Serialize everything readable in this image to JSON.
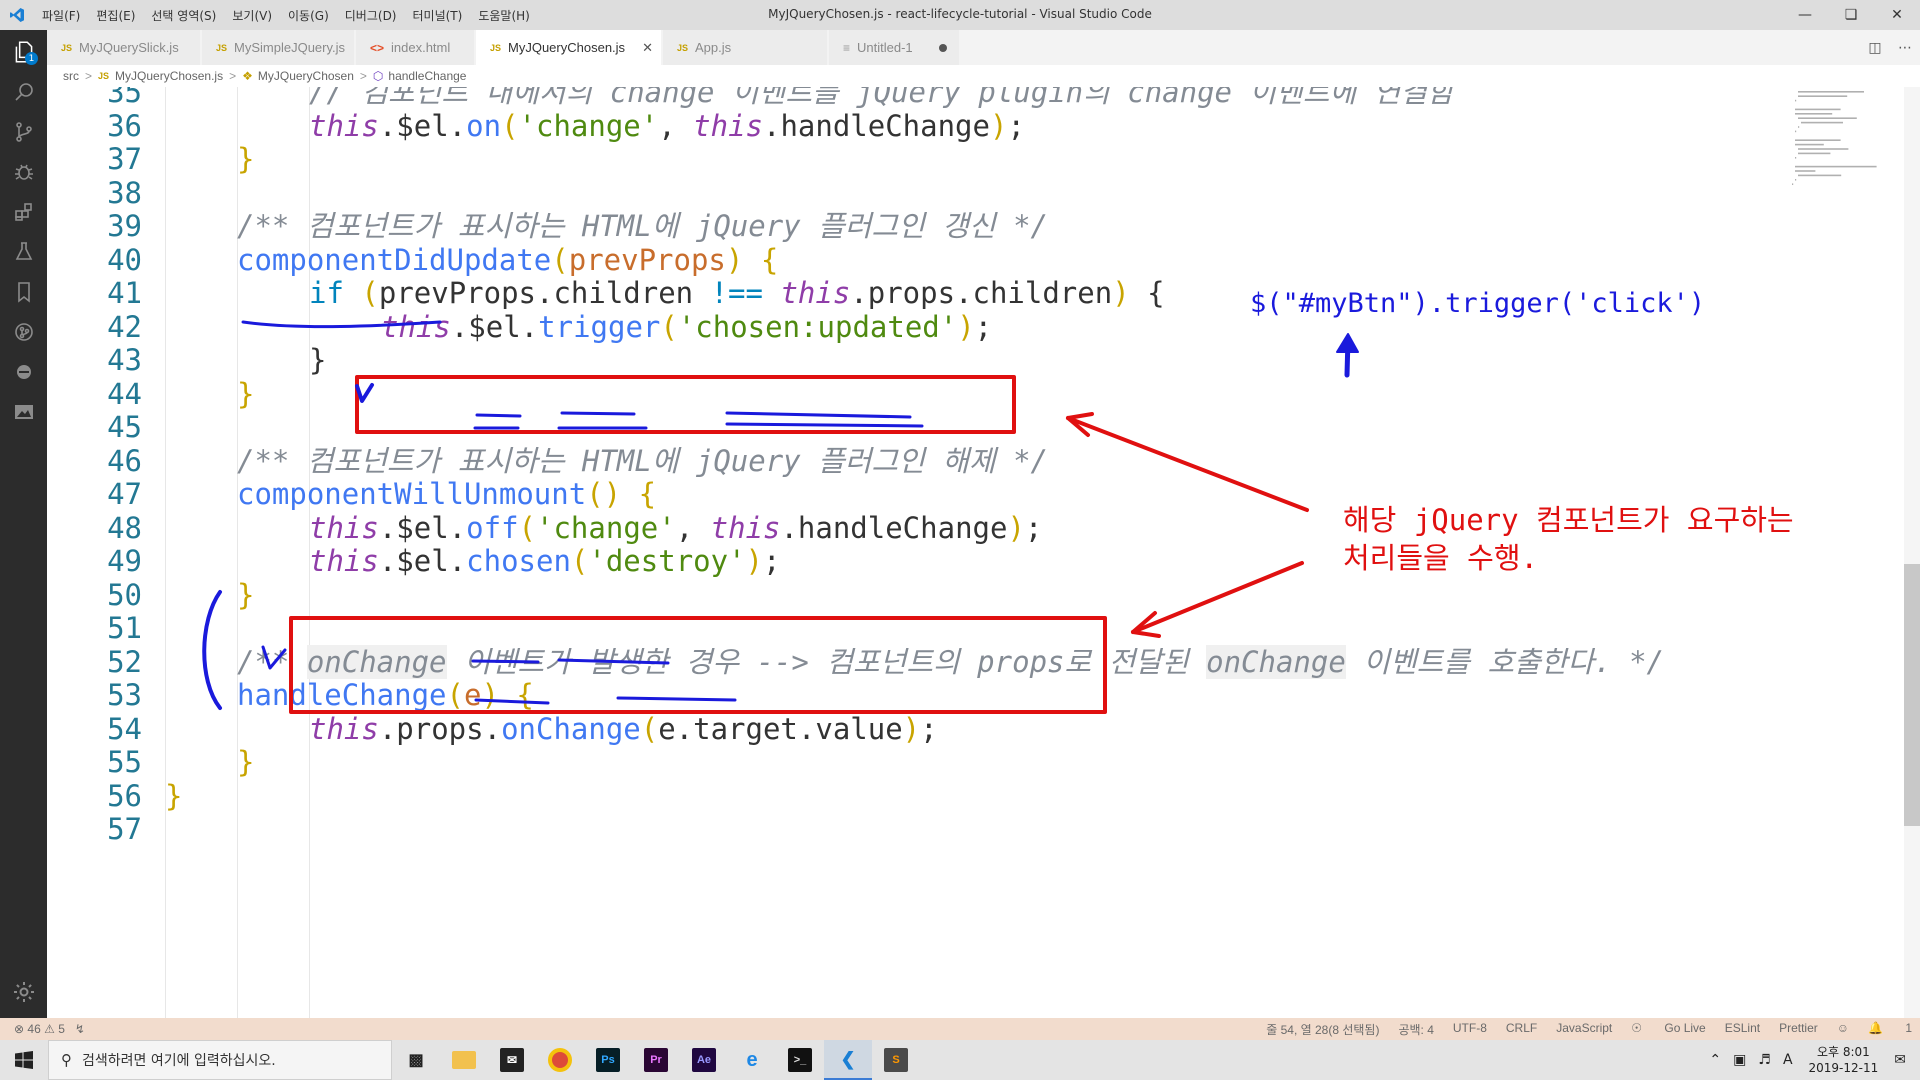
{
  "window": {
    "title": "MyJQueryChosen.js - react-lifecycle-tutorial - Visual Studio Code",
    "menu": [
      "파일(F)",
      "편집(E)",
      "선택 영역(S)",
      "보기(V)",
      "이동(G)",
      "디버그(D)",
      "터미널(T)",
      "도움말(H)"
    ]
  },
  "activity": {
    "badge": "1"
  },
  "tabs": [
    {
      "label": "MyJQuerySlick.js",
      "icon": "JS"
    },
    {
      "label": "MySimpleJQuery.js",
      "icon": "JS"
    },
    {
      "label": "index.html",
      "icon": "<>"
    },
    {
      "label": "MyJQueryChosen.js",
      "icon": "JS",
      "active": true
    },
    {
      "label": "App.js",
      "icon": "JS"
    },
    {
      "label": "Untitled-1",
      "icon": "≡",
      "dirty": true
    }
  ],
  "breadcrumb": [
    "src",
    "MyJQueryChosen.js",
    "MyJQueryChosen",
    "handleChange"
  ],
  "editor": {
    "lines": [
      {
        "n": "35",
        "i": 2,
        "t": [
          [
            "cm",
            "// 컴포넌트 내에서의 change 이벤트를 jQuery plugin의 change 이벤트에 연결함"
          ]
        ]
      },
      {
        "n": "36",
        "i": 2,
        "t": [
          [
            "kw",
            "this"
          ],
          [
            "df",
            ".$el."
          ],
          [
            "fn",
            "on"
          ],
          [
            "pu",
            "("
          ],
          [
            "st",
            "'change'"
          ],
          [
            "df",
            ", "
          ],
          [
            "kw",
            "this"
          ],
          [
            "df",
            ".handleChange"
          ],
          [
            "pu",
            ")"
          ],
          [
            "df",
            ";"
          ]
        ]
      },
      {
        "n": "37",
        "i": 1,
        "t": [
          [
            "pu",
            "}"
          ]
        ]
      },
      {
        "n": "38",
        "i": 0,
        "t": []
      },
      {
        "n": "39",
        "i": 1,
        "t": [
          [
            "cm",
            "/** 컴포넌트가 표시하는 HTML에 jQuery 플러그인 갱신 */"
          ]
        ]
      },
      {
        "n": "40",
        "i": 1,
        "t": [
          [
            "fn",
            "componentDidUpdate"
          ],
          [
            "pu",
            "("
          ],
          [
            "pm",
            "prevProps"
          ],
          [
            "pu",
            ")"
          ],
          [
            "df",
            " "
          ],
          [
            "pu",
            "{"
          ]
        ]
      },
      {
        "n": "41",
        "i": 2,
        "t": [
          [
            "op",
            "if"
          ],
          [
            "df",
            " "
          ],
          [
            "pu",
            "("
          ],
          [
            "df",
            "prevProps.children "
          ],
          [
            "op",
            "!=="
          ],
          [
            "df",
            " "
          ],
          [
            "kw",
            "this"
          ],
          [
            "df",
            ".props.children"
          ],
          [
            "pu",
            ")"
          ],
          [
            "df",
            " {"
          ]
        ]
      },
      {
        "n": "42",
        "i": 3,
        "t": [
          [
            "kw",
            "this"
          ],
          [
            "df",
            ".$el."
          ],
          [
            "fn",
            "trigger"
          ],
          [
            "pu",
            "("
          ],
          [
            "st",
            "'chosen:updated'"
          ],
          [
            "pu",
            ")"
          ],
          [
            "df",
            ";"
          ]
        ]
      },
      {
        "n": "43",
        "i": 2,
        "t": [
          [
            "df",
            "}"
          ]
        ]
      },
      {
        "n": "44",
        "i": 1,
        "t": [
          [
            "pu",
            "}"
          ]
        ]
      },
      {
        "n": "45",
        "i": 0,
        "t": []
      },
      {
        "n": "46",
        "i": 1,
        "t": [
          [
            "cm",
            "/** 컴포넌트가 표시하는 HTML에 jQuery 플러그인 해제 */"
          ]
        ]
      },
      {
        "n": "47",
        "i": 1,
        "t": [
          [
            "fn",
            "componentWillUnmount"
          ],
          [
            "pu",
            "()"
          ],
          [
            "df",
            " "
          ],
          [
            "pu",
            "{"
          ]
        ]
      },
      {
        "n": "48",
        "i": 2,
        "t": [
          [
            "kw",
            "this"
          ],
          [
            "df",
            ".$el."
          ],
          [
            "fn",
            "off"
          ],
          [
            "pu",
            "("
          ],
          [
            "st",
            "'change'"
          ],
          [
            "df",
            ", "
          ],
          [
            "kw",
            "this"
          ],
          [
            "df",
            ".handleChange"
          ],
          [
            "pu",
            ")"
          ],
          [
            "df",
            ";"
          ]
        ]
      },
      {
        "n": "49",
        "i": 2,
        "t": [
          [
            "kw",
            "this"
          ],
          [
            "df",
            ".$el."
          ],
          [
            "fn",
            "chosen"
          ],
          [
            "pu",
            "("
          ],
          [
            "st",
            "'destroy'"
          ],
          [
            "pu",
            ")"
          ],
          [
            "df",
            ";"
          ]
        ]
      },
      {
        "n": "50",
        "i": 1,
        "t": [
          [
            "pu",
            "}"
          ]
        ]
      },
      {
        "n": "51",
        "i": 0,
        "t": []
      },
      {
        "n": "52",
        "i": 1,
        "t": [
          [
            "cm",
            "/** "
          ],
          [
            "cmh",
            "onChange"
          ],
          [
            "cm",
            " 이벤트가 발생한 경우 --> 컴포넌트의 props로 전달된 "
          ],
          [
            "cmh",
            "onChange"
          ],
          [
            "cm",
            " 이벤트를 호출한다. */"
          ]
        ]
      },
      {
        "n": "53",
        "i": 1,
        "t": [
          [
            "fn",
            "handleChange"
          ],
          [
            "pu",
            "("
          ],
          [
            "pm",
            "e"
          ],
          [
            "pu",
            ")"
          ],
          [
            "df",
            " "
          ],
          [
            "pu",
            "{"
          ]
        ]
      },
      {
        "n": "54",
        "i": 2,
        "t": [
          [
            "kw",
            "this"
          ],
          [
            "df",
            ".props."
          ],
          [
            "fn",
            "onChange"
          ],
          [
            "pu",
            "("
          ],
          [
            "df",
            "e.target.value"
          ],
          [
            "pu",
            ")"
          ],
          [
            "df",
            ";"
          ]
        ]
      },
      {
        "n": "55",
        "i": 1,
        "t": [
          [
            "pu",
            "}"
          ]
        ]
      },
      {
        "n": "56",
        "i": 0,
        "t": [
          [
            "pu",
            "}"
          ]
        ]
      },
      {
        "n": "57",
        "i": 0,
        "t": []
      }
    ]
  },
  "annotations": {
    "trigger_example": "$(\"#myBtn\").trigger('click')",
    "note_line1": "해당 jQuery 컴포넌트가 요구하는",
    "note_line2": "처리들을 수행.",
    "blue": "#1a1adc",
    "red": "#e01010"
  },
  "status": {
    "errors": "46",
    "warnings": "5",
    "position": "줄 54, 열 28(8 선택됨)",
    "spaces": "공백: 4",
    "encoding": "UTF-8",
    "eol": "CRLF",
    "language": "JavaScript",
    "golive": "Go Live",
    "eslint": "ESLint",
    "prettier": "Prettier",
    "notifications": "1"
  },
  "taskbar": {
    "search_placeholder": "검색하려면 여기에 입력하십시오.",
    "ampm": "오후 8:01",
    "date": "2019-12-11",
    "ime": "A"
  }
}
